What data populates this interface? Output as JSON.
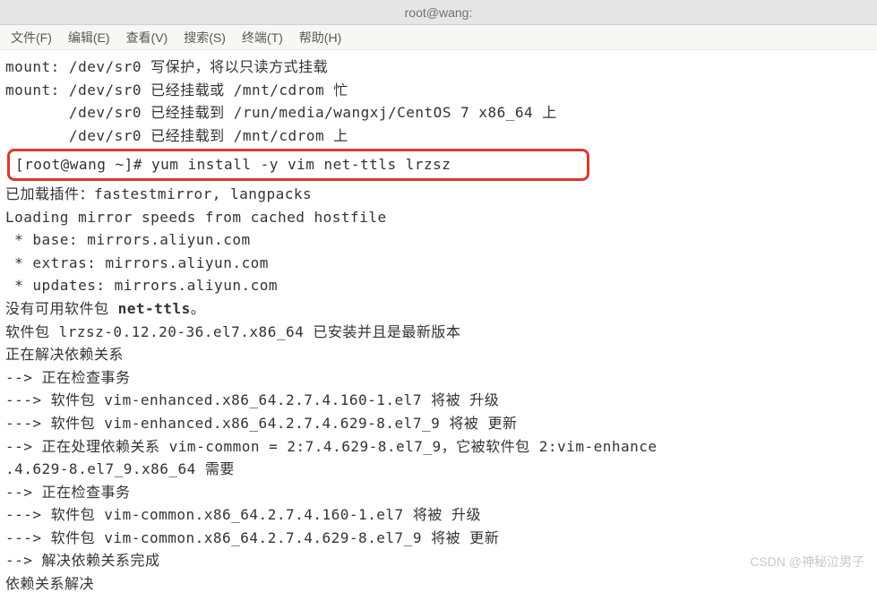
{
  "titlebar": {
    "title": "root@wang:"
  },
  "menubar": {
    "file": "文件(F)",
    "edit": "编辑(E)",
    "view": "查看(V)",
    "search": "搜索(S)",
    "terminal": "终端(T)",
    "help": "帮助(H)"
  },
  "terminal": {
    "lines": {
      "l1": "mount: /dev/sr0 写保护，将以只读方式挂载",
      "l2": "mount: /dev/sr0 已经挂载或 /mnt/cdrom 忙",
      "l3": "       /dev/sr0 已经挂载到 /run/media/wangxj/CentOS 7 x86_64 上",
      "l4": "       /dev/sr0 已经挂载到 /mnt/cdrom 上",
      "prompt": "[root@wang ~]# yum install -y vim net-ttls lrzsz",
      "l5": "已加载插件：fastestmirror, langpacks",
      "l6": "Loading mirror speeds from cached hostfile",
      "l7": " * base: mirrors.aliyun.com",
      "l8": " * extras: mirrors.aliyun.com",
      "l9": " * updates: mirrors.aliyun.com",
      "l10a": "没有可用软件包 ",
      "l10b": "net-ttls",
      "l10c": "。",
      "l11": "软件包 lrzsz-0.12.20-36.el7.x86_64 已安装并且是最新版本",
      "l12": "正在解决依赖关系",
      "l13": "--> 正在检查事务",
      "l14": "---> 软件包 vim-enhanced.x86_64.2.7.4.160-1.el7 将被 升级",
      "l15": "---> 软件包 vim-enhanced.x86_64.2.7.4.629-8.el7_9 将被 更新",
      "l16": "--> 正在处理依赖关系 vim-common = 2:7.4.629-8.el7_9，它被软件包 2:vim-enhance",
      "l17": ".4.629-8.el7_9.x86_64 需要",
      "l18": "--> 正在检查事务",
      "l19": "---> 软件包 vim-common.x86_64.2.7.4.160-1.el7 将被 升级",
      "l20": "---> 软件包 vim-common.x86_64.2.7.4.629-8.el7_9 将被 更新",
      "l21": "--> 解决依赖关系完成",
      "l22": "",
      "l23": "依赖关系解决"
    }
  },
  "watermark": "CSDN @神秘泣男子"
}
